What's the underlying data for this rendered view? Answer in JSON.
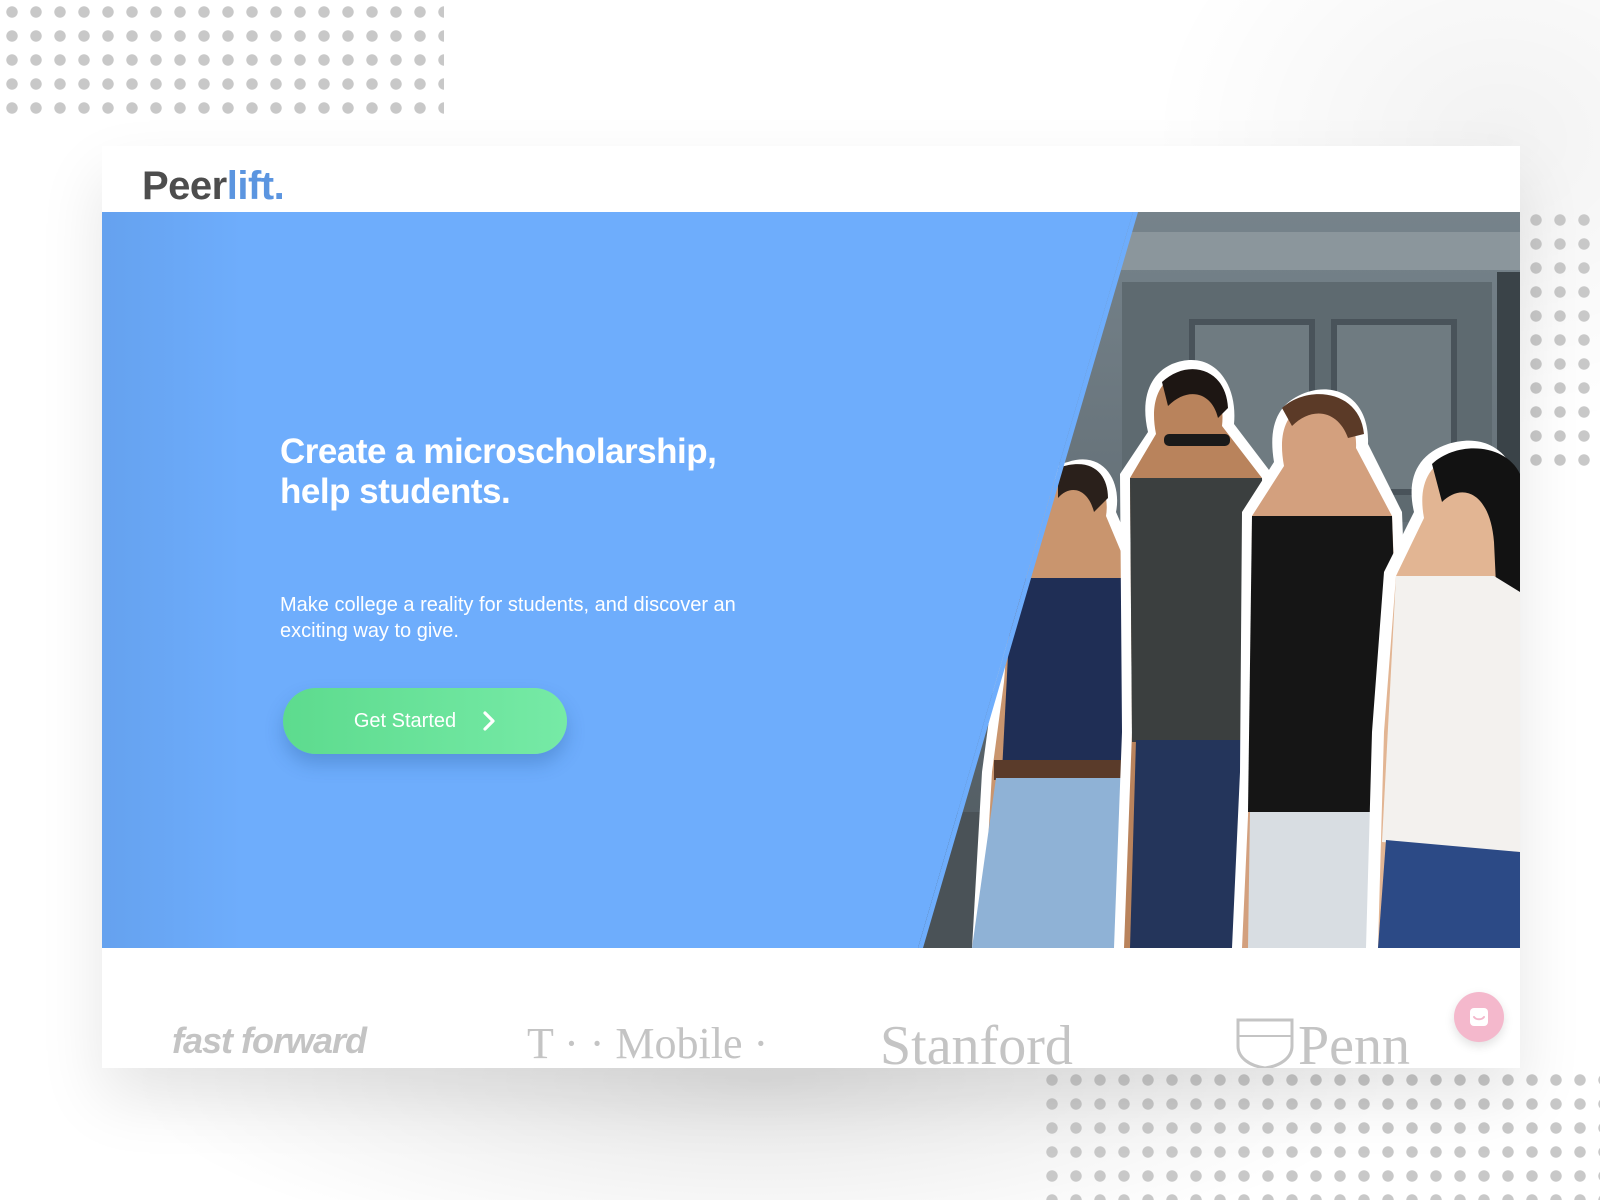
{
  "brand": {
    "logo_part1": "Peer",
    "logo_part2": "lift.",
    "colors": {
      "dark": "#4d4d4d",
      "accent": "#5b95e0"
    }
  },
  "hero": {
    "headline_line1": "Create a microscholarship,",
    "headline_line2": "help students.",
    "subtext_line1": "Make college a reality for students, and discover an",
    "subtext_line2": "exciting way to give.",
    "background": "#6eadfc",
    "cta": {
      "label": "Get Started",
      "icon": "chevron-right-icon",
      "colors": [
        "#5ddb8e",
        "#76eaa6"
      ]
    },
    "photo": "group-of-students-photo"
  },
  "partners": [
    "fast forward",
    "T · · Mobile ·",
    "Stanford",
    "Penn"
  ],
  "chat": {
    "icon": "chat-bubble-icon",
    "color": "#f4b8cc"
  }
}
